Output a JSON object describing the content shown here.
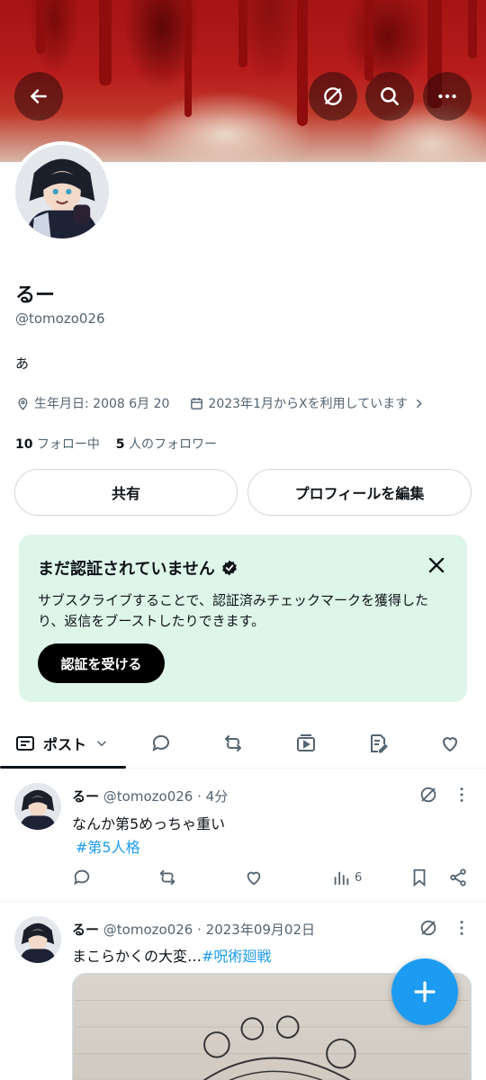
{
  "header": {
    "back_icon": "arrow-left-icon",
    "grok_icon": "slash-circle-icon",
    "search_icon": "search-icon",
    "more_icon": "more-horizontal-icon"
  },
  "profile": {
    "name": "るー",
    "handle": "@tomozo026",
    "bio": "あ",
    "birthday": "生年月日: 2008 6月 20",
    "joined": "2023年1月からXを利用しています",
    "following_count": "10",
    "following_label": "フォロー中",
    "followers_count": "5",
    "followers_label": "人のフォロワー"
  },
  "buttons": {
    "share": "共有",
    "edit_profile": "プロフィールを編集"
  },
  "verify_card": {
    "title": "まだ認証されていません",
    "description": "サブスクライブすることで、認証済みチェックマークを獲得したり、返信をブーストしたりできます。",
    "cta": "認証を受ける"
  },
  "tabs": {
    "posts_label": "ポスト"
  },
  "posts": [
    {
      "name": "るー",
      "handle": "@tomozo026",
      "time": "4分",
      "text": "なんか第5めっちゃ重い",
      "hashtag": "#第5人格",
      "views": "6"
    },
    {
      "name": "るー",
      "handle": "@tomozo026",
      "time": "2023年09月02日",
      "text": "まこらかくの大変…",
      "hashtag": "#呪術廻戦"
    }
  ],
  "colors": {
    "accent": "#1d9bf0",
    "verify_bg": "#def5ea",
    "text_secondary": "#536471"
  }
}
